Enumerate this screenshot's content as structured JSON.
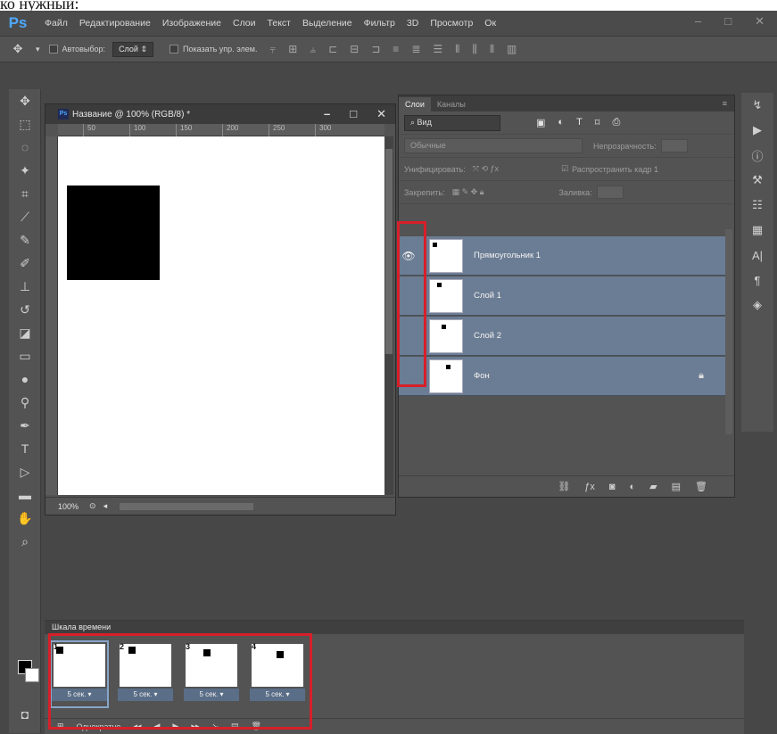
{
  "page_top_text": "ко нужный:",
  "app": {
    "logo": "Ps"
  },
  "menu": [
    "Файл",
    "Редактирование",
    "Изображение",
    "Слои",
    "Текст",
    "Выделение",
    "Фильтр",
    "3D",
    "Просмотр",
    "Ок"
  ],
  "window_controls": [
    "–",
    "□",
    "✕"
  ],
  "options_bar": {
    "autoselect_label": "Автовыбор:",
    "autoselect_value": "Слой",
    "show_transform_label": "Показать упр. элем."
  },
  "document": {
    "title": "Название @ 100% (RGB/8) *",
    "ruler_ticks": [
      "50",
      "100",
      "150",
      "200",
      "250",
      "300"
    ],
    "zoom": "100%"
  },
  "layers_panel": {
    "tabs": [
      "Слои",
      "Каналы"
    ],
    "filter_value": "Вид",
    "blend_mode": "Обычные",
    "opacity_label": "Непрозрачность:",
    "unify_label": "Унифицировать:",
    "propagate_label": "Распространить кадр 1",
    "lock_label": "Закрепить:",
    "fill_label": "Заливка:",
    "layers": [
      {
        "name": "Прямоугольник 1",
        "visible": true,
        "locked": false
      },
      {
        "name": "Слой 1",
        "visible": false,
        "locked": false
      },
      {
        "name": "Слой 2",
        "visible": false,
        "locked": false
      },
      {
        "name": "Фон",
        "visible": false,
        "locked": true
      }
    ]
  },
  "timeline": {
    "title": "Шкала времени",
    "frames": [
      {
        "number": "1",
        "delay": "5 сек. ▾"
      },
      {
        "number": "2",
        "delay": "5 сек. ▾"
      },
      {
        "number": "3",
        "delay": "5 сек. ▾"
      },
      {
        "number": "4",
        "delay": "5 сек. ▾"
      }
    ],
    "loop": "Однократно"
  },
  "colors": {
    "highlight_box": "#d71f2a",
    "selected_layer": "#6b7d94",
    "ps_blue": "#4ea8ff"
  }
}
